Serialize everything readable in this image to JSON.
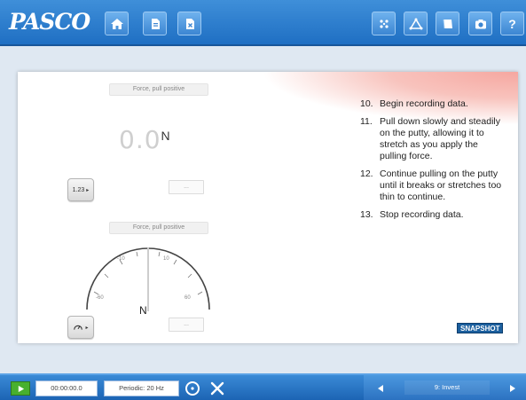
{
  "header": {
    "logo_text": "PASCO",
    "left_buttons": [
      "home-icon",
      "document-icon",
      "close-doc-icon"
    ],
    "right_buttons": [
      "sensors-icon",
      "analysis-icon",
      "journal-icon",
      "camera-icon",
      "help-icon"
    ],
    "help_label": "?"
  },
  "digits_display": {
    "measurement_label": "Force, pull positive",
    "value": "0.0",
    "unit": "N",
    "mode_button_label": "1.23",
    "box_label": "..."
  },
  "meter_display": {
    "measurement_label": "Force, pull positive",
    "tick_labels": [
      "-60",
      "-10",
      "10",
      "60"
    ],
    "unit": "N",
    "box_label": "..."
  },
  "instructions": [
    {
      "num": "10.",
      "text": "Begin recording data."
    },
    {
      "num": "11.",
      "text": "Pull down slowly and steadily on the putty, allowing it to stretch as you apply the pulling force."
    },
    {
      "num": "12.",
      "text": "Continue pulling on the putty until it breaks or stretches too thin to continue."
    },
    {
      "num": "13.",
      "text": "Stop recording data."
    }
  ],
  "snapshot_label": "SNAPSHOT",
  "footer": {
    "time": "00:00:00.0",
    "sampling": "Periodic: 20 Hz",
    "page_label": "9: Invest"
  },
  "colors": {
    "toolbar_blue": "#2a7ccd",
    "play_green": "#48b02f",
    "swoosh_pink": "#f6a7a0"
  }
}
